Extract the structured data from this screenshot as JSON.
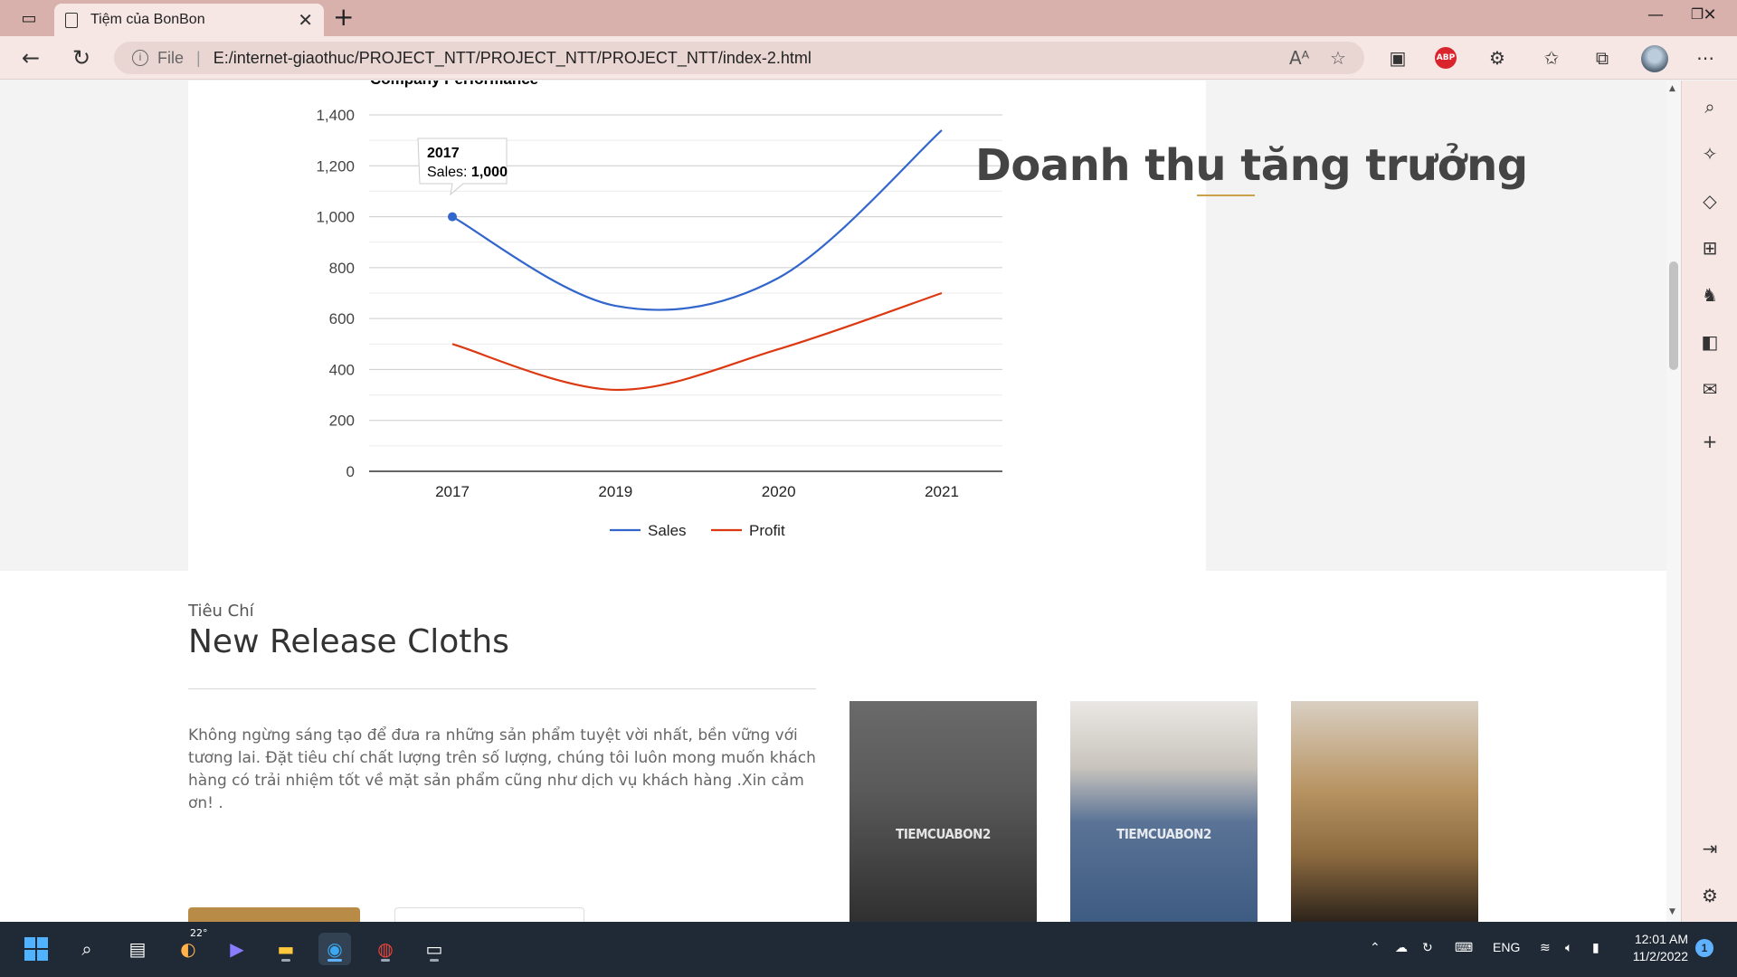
{
  "browser": {
    "tab_title": "Tiệm của BonBon",
    "address_scheme": "File",
    "address_url": "E:/internet-giaothuc/PROJECT_NTT/PROJECT_NTT/PROJECT_NTT/index-2.html",
    "abp_label": "ABP"
  },
  "chart_data": {
    "type": "line",
    "title": "Company Performance",
    "categories": [
      "2017",
      "2019",
      "2020",
      "2021"
    ],
    "series": [
      {
        "name": "Sales",
        "color": "#3366cc",
        "values": [
          1000,
          650,
          760,
          1340
        ]
      },
      {
        "name": "Profit",
        "color": "#dc3912",
        "values": [
          500,
          320,
          480,
          700
        ]
      }
    ],
    "y_ticks": [
      "0",
      "200",
      "400",
      "600",
      "800",
      "1,000",
      "1,200",
      "1,400"
    ],
    "ylim": [
      0,
      1400
    ],
    "grid": true,
    "smooth": true,
    "legend": "bottom",
    "tooltip": {
      "title": "2017",
      "label": "Sales:",
      "value": "1,000"
    }
  },
  "hero": {
    "heading": "Doanh thu tăng trưởng"
  },
  "release": {
    "eyebrow": "Tiêu Chí",
    "title": "New Release Cloths",
    "description": "Không ngừng sáng tạo để đưa ra những sản phẩm tuyệt vời nhất, bền vững với tương lai. Đặt tiêu chí chất lượng trên số lượng, chúng tôi luôn mong muốn khách hàng có trải nhiệm tốt về mặt sản phẩm cũng như dịch vụ khách hàng .Xin cảm ơn! ."
  },
  "products": [
    {
      "watermark": "TIEMCUABON2"
    },
    {
      "watermark": "TIEMCUABON2"
    },
    {
      "watermark": ""
    }
  ],
  "taskbar": {
    "weather_temp": "22°",
    "language": "ENG",
    "time": "12:01 AM",
    "date": "11/2/2022",
    "notifications": "1"
  }
}
